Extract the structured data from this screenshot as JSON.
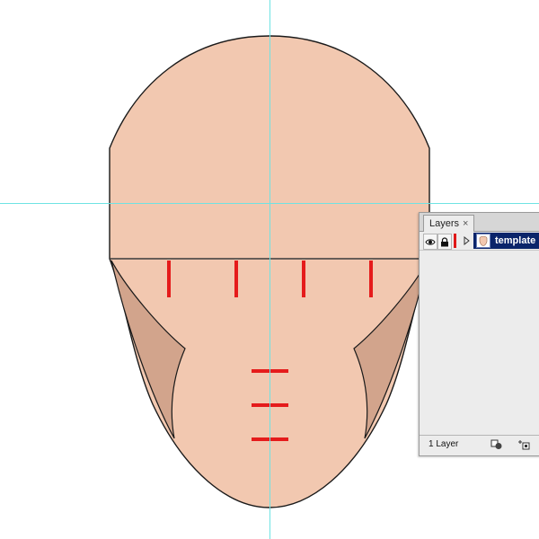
{
  "colors": {
    "skin": "#f2c8b0",
    "shadow": "#d2a48c",
    "outline": "#1a1a1a",
    "guide": "#6fe3e3",
    "mark": "#e51b1b",
    "selection": "#0a246a"
  },
  "layers_panel": {
    "tab_label": "Layers",
    "close_glyph": "×",
    "layer": {
      "name": "template",
      "color_label": "#e01818"
    },
    "layer_count": "1 Layer",
    "icons": {
      "visibility": "eye-icon",
      "lock": "lock-icon",
      "expand": "triangle-right-icon",
      "make_clipping_mask": "clipping-mask-icon",
      "create_sublayer": "new-sublayer-icon"
    }
  }
}
